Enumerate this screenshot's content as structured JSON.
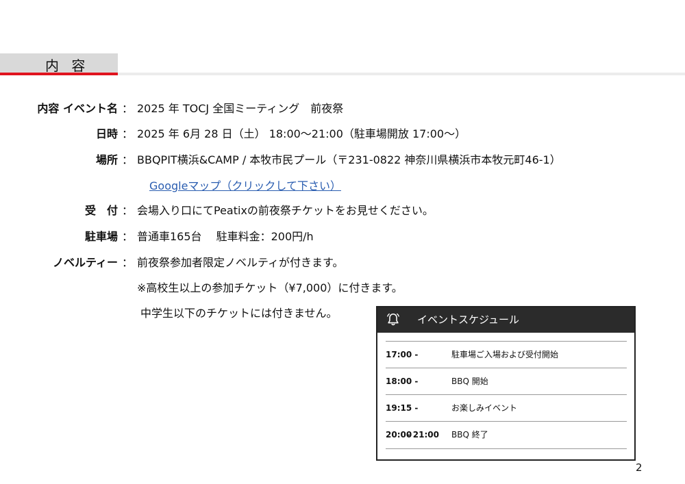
{
  "section_header": "内 容",
  "rows": [
    {
      "label": "内容 イベント名",
      "value": "2025 年 TOCJ 全国ミーティング　前夜祭"
    },
    {
      "label": "日時",
      "value": "2025 年 6月 28 日（土） 18:00～21:00（駐車場開放 17:00～）"
    },
    {
      "label": "場所",
      "value": "BBQPIT横浜&CAMP / 本牧市民プール（〒231-0822 神奈川県横浜市本牧元町46-1）"
    },
    {
      "label": "受　付",
      "value": "会場入り口にてPeatixの前夜祭チケットをお見せください。"
    },
    {
      "label": "駐車場",
      "value": "普通車165台　 駐車料金：200円/h"
    },
    {
      "label": "ノベルティー",
      "value": "前夜祭参加者限定ノベルティが付きます。"
    }
  ],
  "colon": "：",
  "map_link": "Googleマップ（クリックして下さい）",
  "novelty_notes": [
    "※高校生以上の参加チケット（¥7,000）に付きます。",
    "中学生以下のチケットには付きません。"
  ],
  "schedule": {
    "title": "イベントスケジュール",
    "icon": "bell-icon",
    "items": [
      {
        "time": "17:00 -",
        "desc": "駐車場ご入場および受付開始"
      },
      {
        "time": "18:00 -",
        "desc": "BBQ 開始"
      },
      {
        "time": "19:15 - 20:00",
        "desc": "お楽しみイベント"
      },
      {
        "time": "- 21:00",
        "desc": "BBQ 終了"
      }
    ]
  },
  "page_number": "2",
  "colors": {
    "accent": "#e0141e",
    "link": "#2a5db0",
    "card_header": "#2b2b2b"
  }
}
